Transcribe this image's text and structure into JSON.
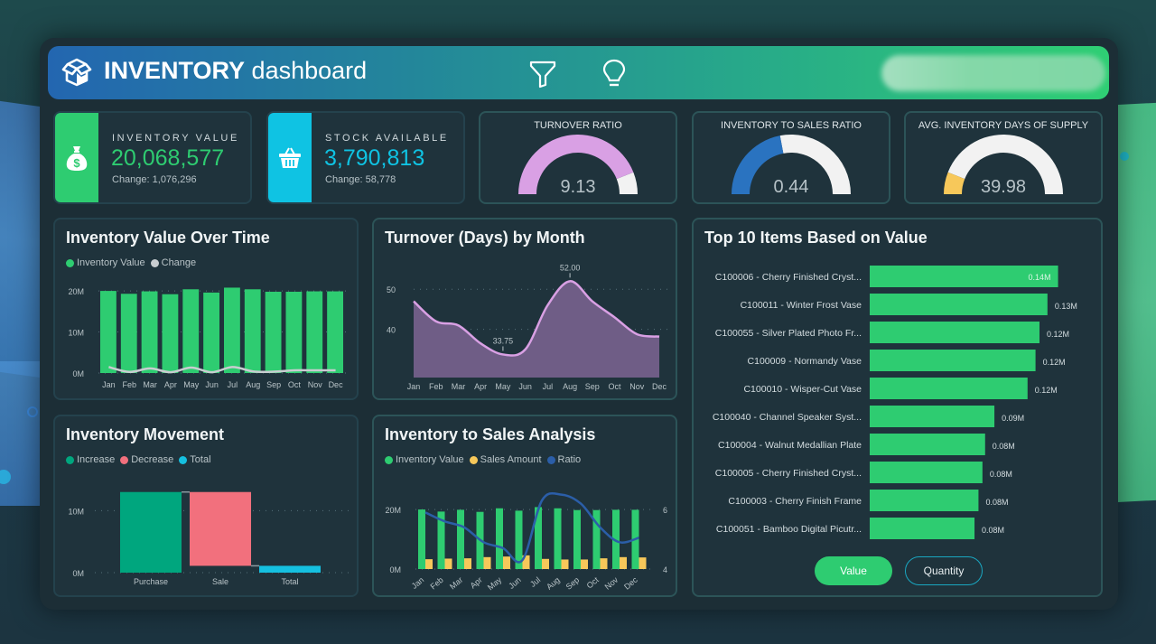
{
  "header": {
    "title_bold": "INVENTORY",
    "title_light": "dashboard",
    "icons": [
      "box-logo-icon",
      "filter-icon",
      "lightbulb-icon"
    ]
  },
  "kpis": [
    {
      "label": "INVENTORY VALUE",
      "value": "20,068,577",
      "change": "Change: 1,076,296",
      "icon": "money-bag-icon",
      "color": "#2ecc71"
    },
    {
      "label": "STOCK AVAILABLE",
      "value": "3,790,813",
      "change": "Change: 58,778",
      "icon": "basket-icon",
      "color": "#0fc3e3"
    }
  ],
  "gauges": [
    {
      "label": "TURNOVER RATIO",
      "value": "9.13",
      "fill_fraction": 0.88,
      "color": "#d9a0e4",
      "track": "#f2f2f2"
    },
    {
      "label": "INVENTORY TO SALES RATIO",
      "value": "0.44",
      "fill_fraction": 0.44,
      "color": "#2a73c0",
      "track": "#f2f2f2"
    },
    {
      "label": "AVG. INVENTORY DAYS OF SUPPLY",
      "value": "39.98",
      "fill_fraction": 0.12,
      "color": "#f7c85a",
      "track": "#f2f2f2"
    }
  ],
  "panels": {
    "value_over_time": "Inventory Value Over Time",
    "turnover": "Turnover (Days) by Month",
    "movement": "Inventory Movement",
    "inv_sales": "Inventory to Sales Analysis",
    "top10": "Top 10 Items Based on Value"
  },
  "toggles": {
    "value": "Value",
    "quantity": "Quantity",
    "active": "value"
  },
  "chart_data": [
    {
      "id": "value_over_time",
      "type": "bar",
      "title": "Inventory Value Over Time",
      "categories": [
        "Jan",
        "Feb",
        "Mar",
        "Apr",
        "May",
        "Jun",
        "Jul",
        "Aug",
        "Sep",
        "Oct",
        "Nov",
        "Dec"
      ],
      "series": [
        {
          "name": "Inventory Value",
          "type": "bar",
          "color": "#2ecc71",
          "values": [
            20.0,
            19.3,
            19.9,
            19.2,
            20.4,
            19.6,
            20.8,
            20.4,
            19.8,
            19.8,
            19.9,
            19.9
          ]
        },
        {
          "name": "Change",
          "type": "line",
          "color": "#c8cdd0",
          "values": [
            1.2,
            -0.6,
            0.7,
            -0.7,
            1.0,
            -0.7,
            1.2,
            -0.4,
            -0.5,
            0.0,
            0.0,
            0.0
          ]
        }
      ],
      "yticks": [
        "0M",
        "10M",
        "20M"
      ],
      "ylim": [
        0,
        22
      ],
      "legend": "top-left"
    },
    {
      "id": "turnover",
      "type": "area",
      "title": "Turnover (Days) by Month",
      "categories": [
        "Jan",
        "Feb",
        "Mar",
        "Apr",
        "May",
        "Jun",
        "Jul",
        "Aug",
        "Sep",
        "Oct",
        "Nov",
        "Dec"
      ],
      "series": [
        {
          "name": "Turnover Days",
          "color": "#d9a0e4",
          "fill": "#6f5d86",
          "values": [
            47.0,
            42.0,
            41.0,
            36.5,
            33.75,
            35.0,
            46.0,
            52.0,
            47.0,
            43.0,
            38.8,
            38.2
          ]
        }
      ],
      "annotations": [
        {
          "x": "May",
          "label": "33.75"
        },
        {
          "x": "Aug",
          "label": "52.00"
        }
      ],
      "yticks": [
        "40",
        "50"
      ],
      "ylim": [
        28,
        55
      ]
    },
    {
      "id": "movement",
      "type": "bar",
      "subtype": "waterfall",
      "title": "Inventory Movement",
      "categories": [
        "Purchase",
        "Sale",
        "Total"
      ],
      "series": [
        {
          "name": "Increase",
          "color": "#00a67e"
        },
        {
          "name": "Decrease",
          "color": "#f2707d"
        },
        {
          "name": "Total",
          "color": "#15c0e0"
        }
      ],
      "steps": [
        {
          "category": "Purchase",
          "kind": "Increase",
          "start": 0,
          "end": 13.0
        },
        {
          "category": "Sale",
          "kind": "Decrease",
          "start": 13.0,
          "end": 1.1
        },
        {
          "category": "Total",
          "kind": "Total",
          "start": 0,
          "end": 1.1
        }
      ],
      "yticks": [
        "0M",
        "10M"
      ],
      "ylim": [
        0,
        15
      ]
    },
    {
      "id": "inv_sales",
      "type": "bar",
      "title": "Inventory to Sales Analysis",
      "categories": [
        "Jan",
        "Feb",
        "Mar",
        "Apr",
        "May",
        "Jun",
        "Jul",
        "Aug",
        "Sep",
        "Oct",
        "Nov",
        "Dec"
      ],
      "series": [
        {
          "name": "Inventory Value",
          "type": "bar",
          "color": "#2ecc71",
          "values": [
            20.0,
            19.3,
            19.9,
            19.2,
            20.4,
            19.6,
            20.8,
            20.4,
            19.8,
            19.8,
            19.9,
            19.9
          ]
        },
        {
          "name": "Sales Amount",
          "type": "bar",
          "color": "#f7c85a",
          "values": [
            3.3,
            3.5,
            3.6,
            4.0,
            4.2,
            4.6,
            3.4,
            3.2,
            3.2,
            3.6,
            4.0,
            3.9
          ]
        },
        {
          "name": "Ratio",
          "type": "line",
          "axis": "right",
          "color": "#2b5ea8",
          "values": [
            5.9,
            5.6,
            5.4,
            4.9,
            4.7,
            4.3,
            6.3,
            6.5,
            6.2,
            5.4,
            4.9,
            5.05
          ]
        }
      ],
      "yticks_left": [
        "0M",
        "20M"
      ],
      "ylim_left": [
        0,
        27
      ],
      "yticks_right": [
        "4",
        "6"
      ],
      "ylim_right": [
        4,
        6.7
      ]
    },
    {
      "id": "top10",
      "type": "bar",
      "orientation": "horizontal",
      "title": "Top 10 Items Based on Value",
      "categories": [
        "C100006 - Cherry Finished Cryst...",
        "C100011 - Winter Frost Vase",
        "C100055 - Silver Plated Photo Fr...",
        "C100009 - Normandy Vase",
        "C100010 - Wisper-Cut Vase",
        "C100040 - Channel Speaker Syst...",
        "C100004 - Walnut Medallian Plate",
        "C100005 - Cherry Finished Cryst...",
        "C100003 - Cherry Finish Frame",
        "C100051 - Bamboo Digital Picutr..."
      ],
      "values": [
        0.142,
        0.134,
        0.128,
        0.125,
        0.119,
        0.094,
        0.087,
        0.085,
        0.082,
        0.079
      ],
      "labels": [
        "0.14M",
        "0.13M",
        "0.12M",
        "0.12M",
        "0.12M",
        "0.09M",
        "0.08M",
        "0.08M",
        "0.08M",
        "0.08M"
      ],
      "color": "#2ecc71",
      "xlim": [
        0,
        0.16
      ]
    }
  ]
}
